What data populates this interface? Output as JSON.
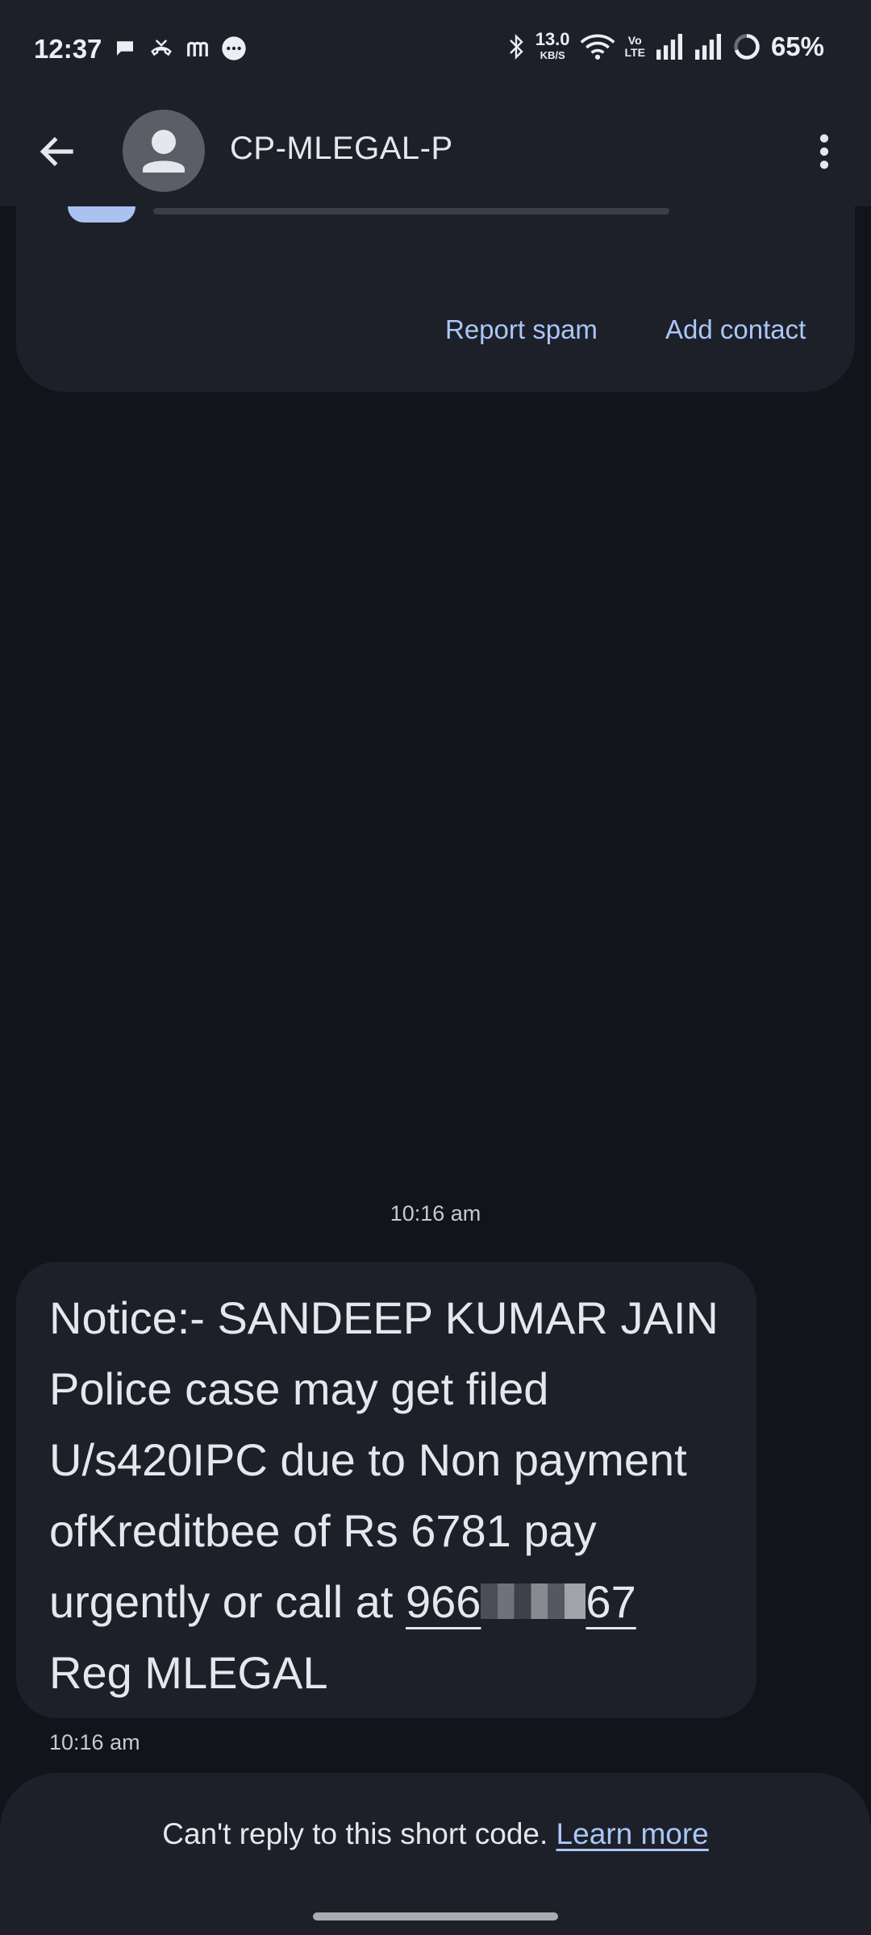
{
  "status_bar": {
    "time": "12:37",
    "left_icons": [
      "chat-bubble-icon",
      "missed-call-icon",
      "m-app-icon",
      "more-bubble-icon"
    ],
    "net_speed_value": "13.0",
    "net_speed_unit": "KB/S",
    "volte_top": "Vo",
    "volte_bottom": "LTE",
    "battery": "65%"
  },
  "header": {
    "contact_name": "CP-MLEGAL-P"
  },
  "spam_card": {
    "report_spam_label": "Report spam",
    "add_contact_label": "Add contact"
  },
  "conversation": {
    "date_separator": "10:16 am",
    "message": {
      "text_before_number": "Notice:- SANDEEP KUMAR JAIN Police case may get filed U/s420IPC due to Non payment ofKreditbee of Rs 6781 pay urgently or call at ",
      "phone_prefix": "966",
      "phone_suffix": "67",
      "text_after_number": " Reg MLEGAL",
      "timestamp": "10:16 am"
    }
  },
  "footer": {
    "notice_text": "Can't reply to this short code. ",
    "learn_more_label": "Learn more"
  },
  "colors": {
    "background": "#11141b",
    "surface": "#1d2029",
    "accent": "#abc6f6",
    "text": "#e6e7ec"
  }
}
